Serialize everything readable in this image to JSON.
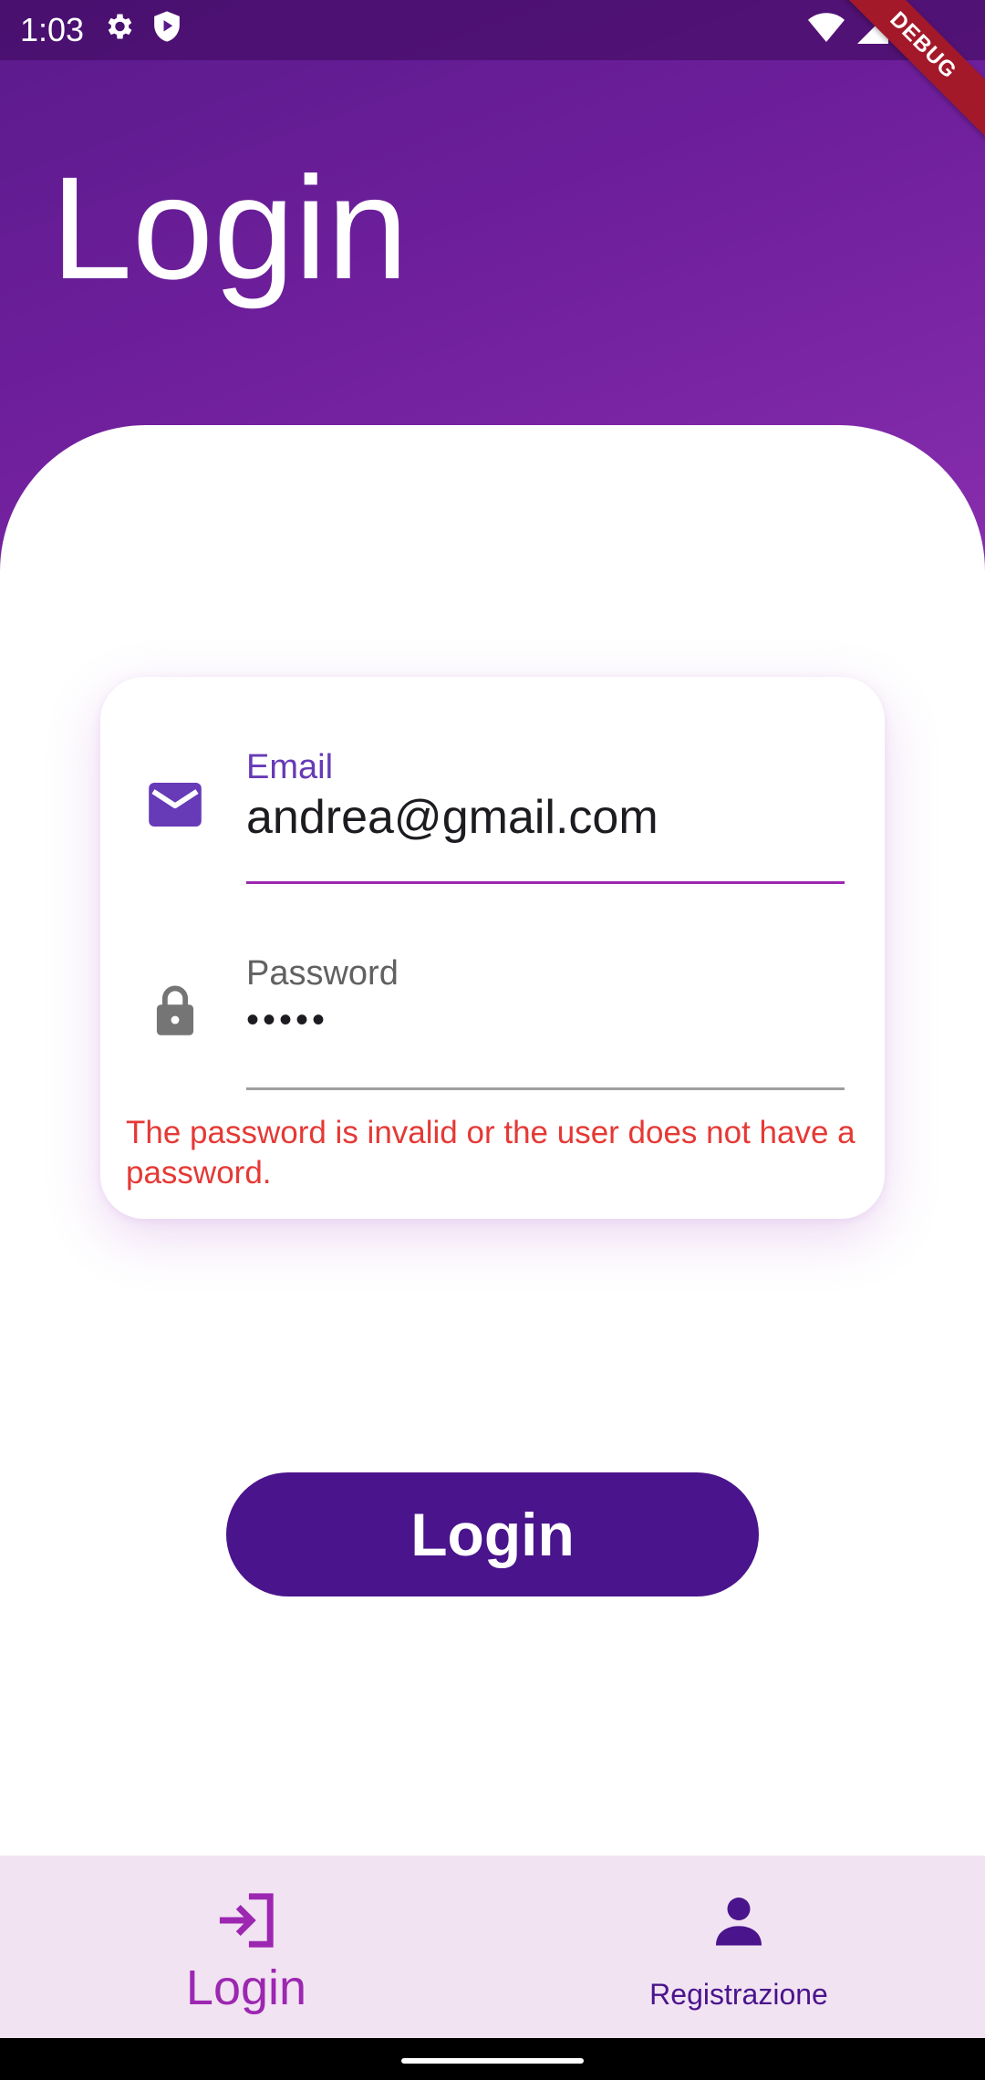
{
  "status_bar": {
    "time": "1:03",
    "debug_label": "DEBUG"
  },
  "page": {
    "title": "Login"
  },
  "form": {
    "email": {
      "label": "Email",
      "value": "andrea@gmail.com",
      "icon": "mail-icon"
    },
    "password": {
      "label": "Password",
      "value": "•••••",
      "icon": "lock-icon"
    },
    "error_message": "The password is invalid or the user does not have a password."
  },
  "actions": {
    "login_label": "Login"
  },
  "bottom_nav": {
    "items": [
      {
        "label": "Login",
        "icon": "login-arrow-icon",
        "active": true
      },
      {
        "label": "Registrazione",
        "icon": "person-icon",
        "active": false
      }
    ]
  },
  "colors": {
    "primary": "#4a148c",
    "accent": "#9c27b0",
    "focus_label": "#673ab7",
    "error": "#e53935",
    "nav_background": "#f2e3f3"
  }
}
